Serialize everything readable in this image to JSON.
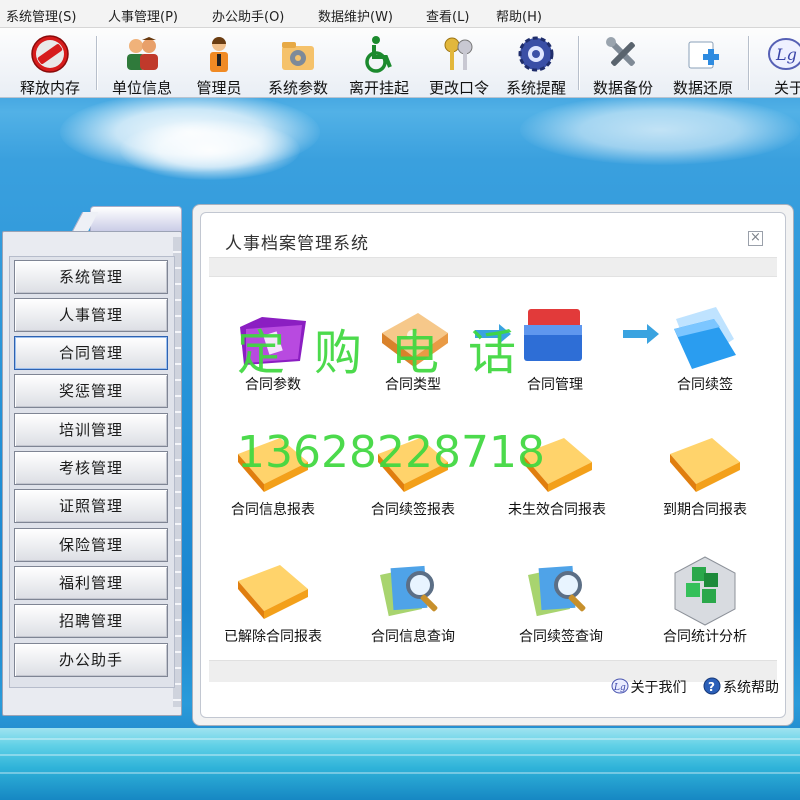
{
  "menu": [
    "系统管理(S)",
    "人事管理(P)",
    "办公助手(O)",
    "数据维护(W)",
    "查看(L)",
    "帮助(H)"
  ],
  "toolbar": [
    {
      "label": "释放内存",
      "icon": "no-entry-icon"
    },
    {
      "label": "单位信息",
      "icon": "users-icon"
    },
    {
      "label": "管理员",
      "icon": "admin-icon"
    },
    {
      "label": "系统参数",
      "icon": "settings-folder-icon"
    },
    {
      "label": "离开挂起",
      "icon": "wheelchair-icon"
    },
    {
      "label": "更改口令",
      "icon": "keys-icon"
    },
    {
      "label": "系统提醒",
      "icon": "reminder-gear-icon"
    },
    {
      "label": "数据备份",
      "icon": "tools-icon"
    },
    {
      "label": "数据还原",
      "icon": "restore-icon"
    },
    {
      "label": "关于",
      "icon": "about-logo-icon"
    }
  ],
  "nav": [
    "系统管理",
    "人事管理",
    "合同管理",
    "奖惩管理",
    "培训管理",
    "考核管理",
    "证照管理",
    "保险管理",
    "福利管理",
    "招聘管理",
    "办公助手"
  ],
  "nav_active": "合同管理",
  "main": {
    "title": "人事档案管理系统",
    "close_symbol": "×",
    "items": [
      {
        "label": "合同参数",
        "icon": "purple-folder-icon"
      },
      {
        "label": "合同类型",
        "icon": "orange-folder-icon"
      },
      {
        "label": "合同管理",
        "icon": "red-blue-folders-icon"
      },
      {
        "label": "合同续签",
        "icon": "blue-folder-icon"
      },
      {
        "label": "合同信息报表",
        "icon": "orange-folder-icon"
      },
      {
        "label": "合同续签报表",
        "icon": "orange-folder-icon"
      },
      {
        "label": "未生效合同报表",
        "icon": "orange-folder-icon"
      },
      {
        "label": "到期合同报表",
        "icon": "orange-folder-icon"
      },
      {
        "label": "已解除合同报表",
        "icon": "orange-folder-icon"
      },
      {
        "label": "合同信息查询",
        "icon": "magnifier-documents-icon"
      },
      {
        "label": "合同续签查询",
        "icon": "magnifier-documents-icon"
      },
      {
        "label": "合同统计分析",
        "icon": "green-cubes-icon"
      }
    ],
    "footer_links": [
      {
        "label": "关于我们",
        "icon": "about-logo-icon"
      },
      {
        "label": "系统帮助",
        "icon": "help-icon"
      }
    ]
  },
  "watermark": {
    "line1": "定购电话",
    "line2": "13628228718"
  },
  "colors": {
    "accent": "#2f62b0",
    "watermark": "#3fd83f",
    "folder_orange": "#f3a01a"
  }
}
